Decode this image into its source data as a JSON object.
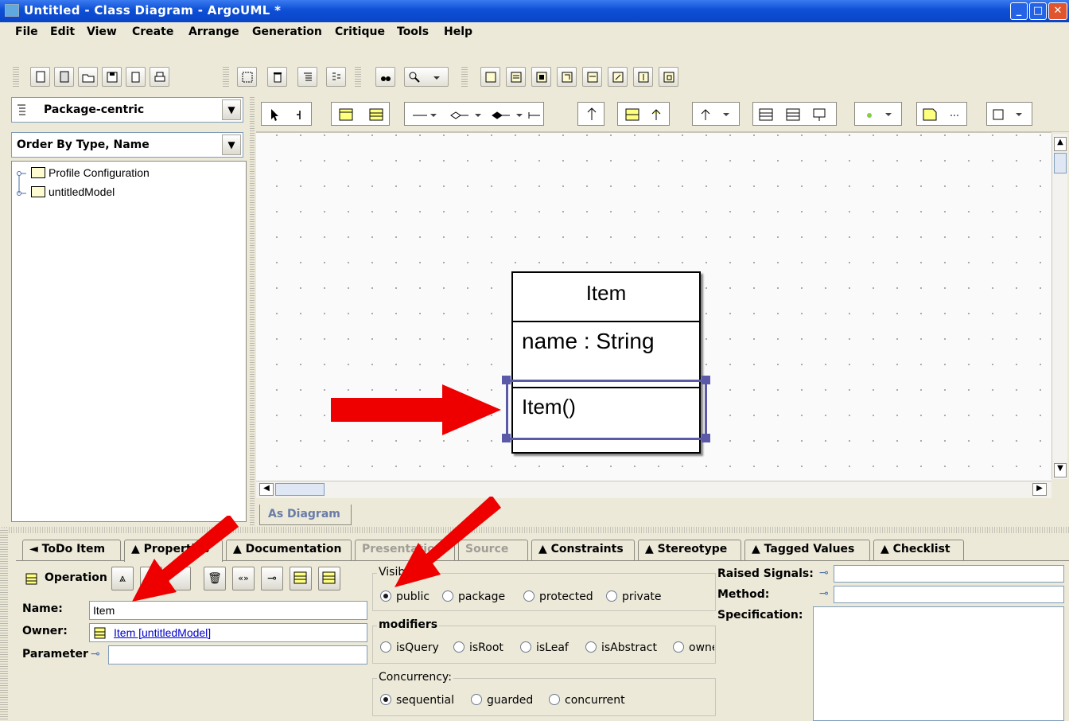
{
  "window": {
    "title": "Untitled - Class Diagram - ArgoUML *"
  },
  "menu": [
    "File",
    "Edit",
    "View",
    "Create",
    "Arrange",
    "Generation",
    "Critique",
    "Tools",
    "Help"
  ],
  "explorer": {
    "perspective": "Package-centric",
    "order": "Order By Type, Name",
    "tree": [
      "Profile Configuration",
      "untitledModel"
    ]
  },
  "diagram": {
    "tab_label": "As Diagram",
    "class": {
      "name": "Item",
      "attribute": "name : String",
      "operation": "Item()"
    }
  },
  "details": {
    "tabs": [
      "◄ ToDo Item",
      "▲ Properties",
      "▲ Documentation",
      "Presentation",
      "Source",
      "▲ Constraints",
      "▲ Stereotype",
      "▲ Tagged Values",
      "▲ Checklist"
    ],
    "element_type": "Operation",
    "name_label": "Name:",
    "name_value": "Item",
    "owner_label": "Owner:",
    "owner_value": "Item [untitledModel]",
    "parameter_label": "Parameter",
    "visibility_title": "Visibility:",
    "visibility_options": [
      "public",
      "package",
      "protected",
      "private"
    ],
    "visibility_selected": "public",
    "modifiers_title": "modifiers",
    "modifiers": [
      "isQuery",
      "isRoot",
      "isLeaf",
      "isAbstract",
      "owner"
    ],
    "concurrency_title": "Concurrency:",
    "concurrency_options": [
      "sequential",
      "guarded",
      "concurrent"
    ],
    "concurrency_selected": "sequential",
    "raised_signals_label": "Raised Signals:",
    "method_label": "Method:",
    "specification_label": "Specification:"
  },
  "colors": {
    "titlebar": "#0d4fd6",
    "arrow": "#ee0000",
    "selection": "#5a5aa8",
    "link": "#0000cc"
  }
}
